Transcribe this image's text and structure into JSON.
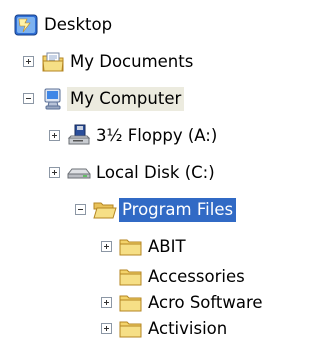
{
  "tree": {
    "desktop": {
      "label": "Desktop",
      "icon": "desktop-icon"
    },
    "my_documents": {
      "label": "My Documents",
      "icon": "my-documents-icon",
      "expander": "collapsed"
    },
    "my_computer": {
      "label": "My Computer",
      "icon": "my-computer-icon",
      "expander": "expanded"
    },
    "floppy": {
      "label": "3½ Floppy (A:)",
      "icon": "floppy-drive-icon",
      "expander": "collapsed"
    },
    "local_disk": {
      "label": "Local Disk (C:)",
      "icon": "hard-disk-icon",
      "expander": "collapsed"
    },
    "program_files": {
      "label": "Program Files",
      "icon": "folder-open-icon",
      "expander": "expanded",
      "selected": true
    },
    "abit": {
      "label": "ABIT",
      "icon": "folder-icon",
      "expander": "collapsed"
    },
    "accessories": {
      "label": "Accessories",
      "icon": "folder-icon"
    },
    "acro_software": {
      "label": "Acro Software",
      "icon": "folder-icon",
      "expander": "collapsed"
    },
    "activision": {
      "label": "Activision",
      "icon": "folder-icon",
      "expander": "collapsed"
    }
  },
  "colors": {
    "selection": "#316ac5",
    "hover_highlight": "#ecebdf",
    "folder": "#f3d36b"
  }
}
